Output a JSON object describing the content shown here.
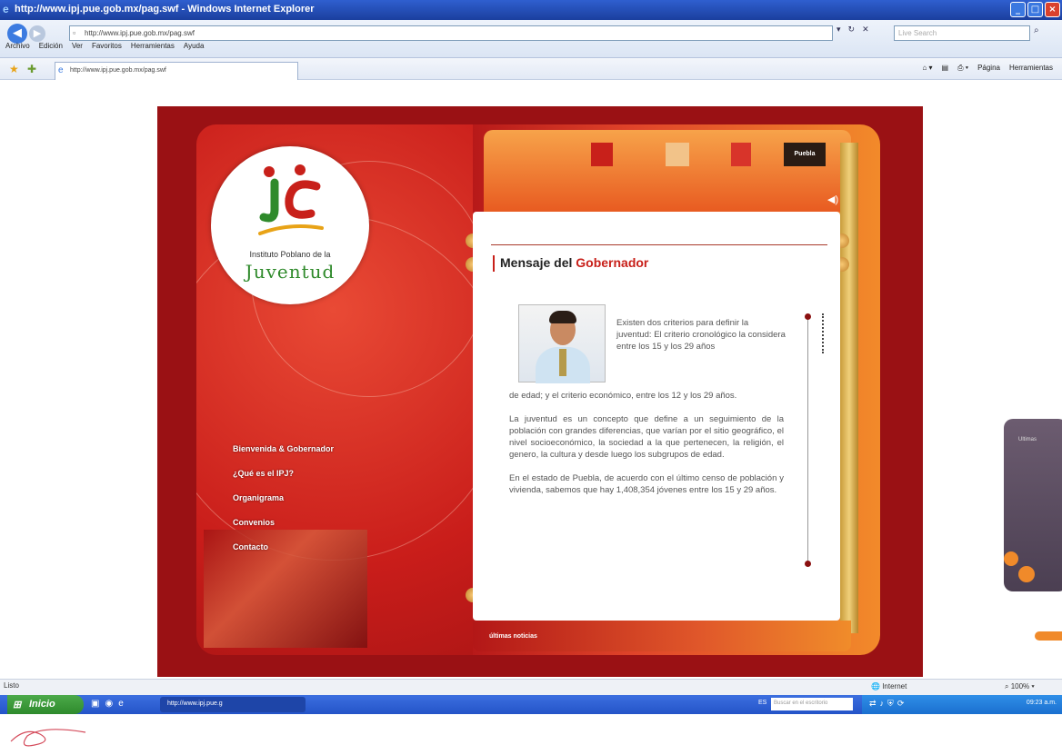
{
  "browser": {
    "title": "http://www.ipj.pue.gob.mx/pag.swf - Windows Internet Explorer",
    "address": "http://www.ipj.pue.gob.mx/pag.swf",
    "search_placeholder": "Live Search",
    "menu": [
      "Archivo",
      "Edición",
      "Ver",
      "Favoritos",
      "Herramientas",
      "Ayuda"
    ],
    "tab_title": "http://www.ipj.pue.gob.mx/pag.swf",
    "commands": {
      "page": "Página",
      "tools": "Herramientas"
    },
    "status": "Listo",
    "zone": "Internet",
    "zoom": "100%"
  },
  "site": {
    "logo_line1": "Instituto Poblano de la",
    "logo_line2": "Juventud",
    "menu": [
      "Bienvenida & Gobernador",
      "¿Qué es el IPJ?",
      "Organigrama",
      "Convenios",
      "Contacto"
    ],
    "sponsors": [
      "Puebla",
      "Puebla"
    ],
    "heading_prefix": "Mensaje del",
    "heading_highlight": "Gobernador",
    "intro": "Existen dos criterios para definir la juventud: El criterio cronológico la considera entre los 15 y los 29 años",
    "p1": "de edad; y el criterio económico, entre los 12 y los 29 años.",
    "p2": "La juventud es un concepto que define a un seguimiento de la población con grandes diferencias, que varían por el sitio geográfico, el nivel socioeconómico, la sociedad a la que pertenecen, la religión, el genero, la cultura y desde luego los subgrupos de edad.",
    "p3": "En el estado de Puebla, de acuerdo con el último censo de población y vivienda, sabemos que hay 1,408,354 jóvenes entre los 15 y 29 años.",
    "news_label": "últimas noticias",
    "side_widget_label": "Ultimas"
  },
  "taskbar": {
    "start": "Inicio",
    "window": "http://www.ipj.pue.g",
    "lang": "ES",
    "search_placeholder": "Buscar en el escritorio",
    "clock": "09:23 a.m."
  },
  "colors": {
    "brand_red": "#c8201a",
    "logo_green": "#2f8a2b",
    "accent_orange": "#f08a2a"
  }
}
